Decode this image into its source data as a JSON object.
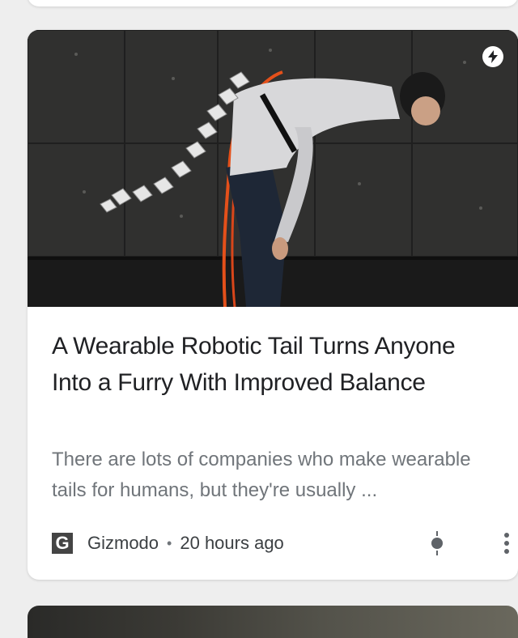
{
  "article": {
    "title": "A Wearable Robotic Tail Turns Anyone Into a Furry With Improved Balance",
    "snippet": "There are lots of companies who make wearable tails for humans, but they're usually ...",
    "source": "Gizmodo",
    "source_favicon_letter": "G",
    "separator": "•",
    "time_ago": "20 hours ago"
  },
  "icons": {
    "amp": "lightning-bolt-icon",
    "tts": "text-to-speech-icon",
    "more": "more-vert-icon"
  },
  "colors": {
    "card_bg": "#ffffff",
    "page_bg": "#eeeeee",
    "title_text": "#202124",
    "snippet_text": "#70757a"
  }
}
